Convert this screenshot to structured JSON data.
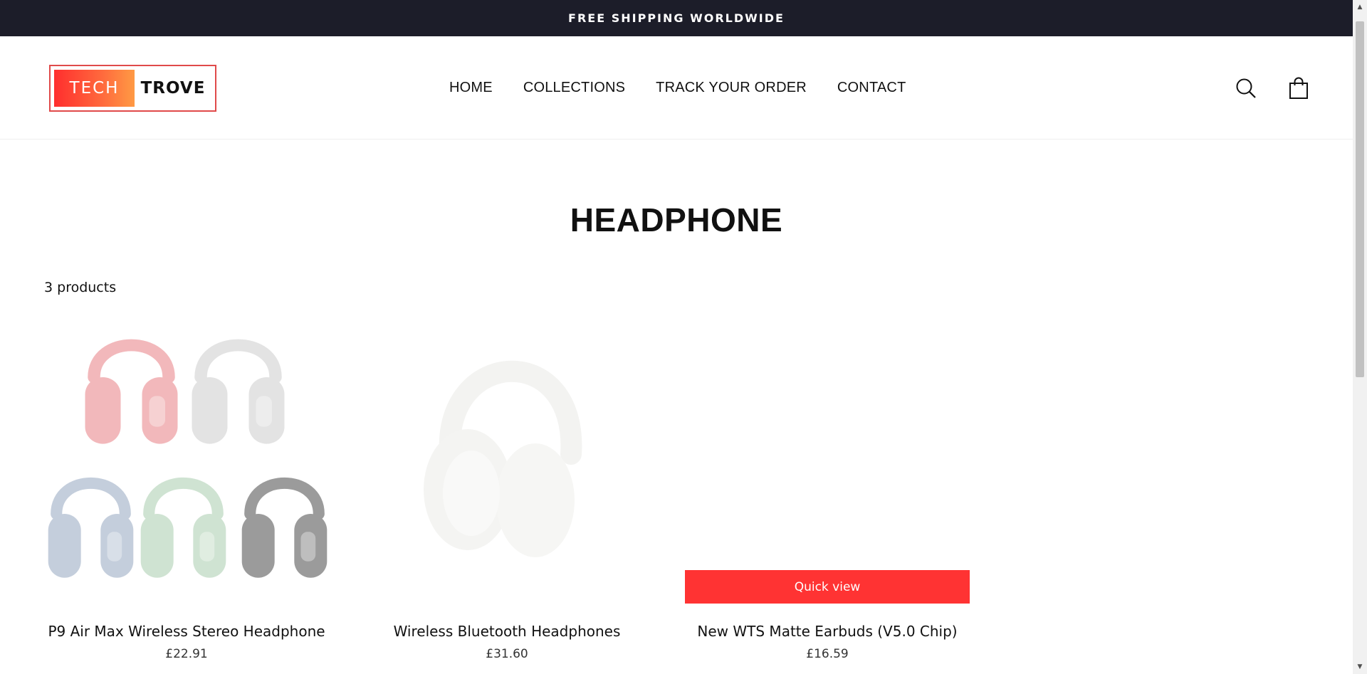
{
  "announcement": {
    "text": "FREE SHIPPING WORLDWIDE"
  },
  "logo": {
    "left_text": "TECH",
    "right_text": "TROVE"
  },
  "nav": {
    "items": [
      {
        "label": "HOME"
      },
      {
        "label": "COLLECTIONS"
      },
      {
        "label": "TRACK YOUR ORDER"
      },
      {
        "label": "CONTACT"
      }
    ]
  },
  "header_icons": {
    "search": "search-icon",
    "cart": "cart-icon"
  },
  "collection": {
    "title": "HEADPHONE",
    "product_count": "3 products"
  },
  "products": [
    {
      "title": "P9 Air Max Wireless Stereo Headphone",
      "price": "£22.91"
    },
    {
      "title": "Wireless Bluetooth Headphones",
      "price": "£31.60"
    },
    {
      "title": "New WTS Matte Earbuds (V5.0 Chip)",
      "price": "£16.59",
      "quick_view": "Quick view"
    }
  ],
  "colors": {
    "announcement_bg": "#1c1d29",
    "accent": "#ff3333",
    "headphone_colors": [
      "#f2b8bb",
      "#e9e9e9",
      "#c4cedc",
      "#cfe3d2",
      "#9b9b9b"
    ]
  }
}
